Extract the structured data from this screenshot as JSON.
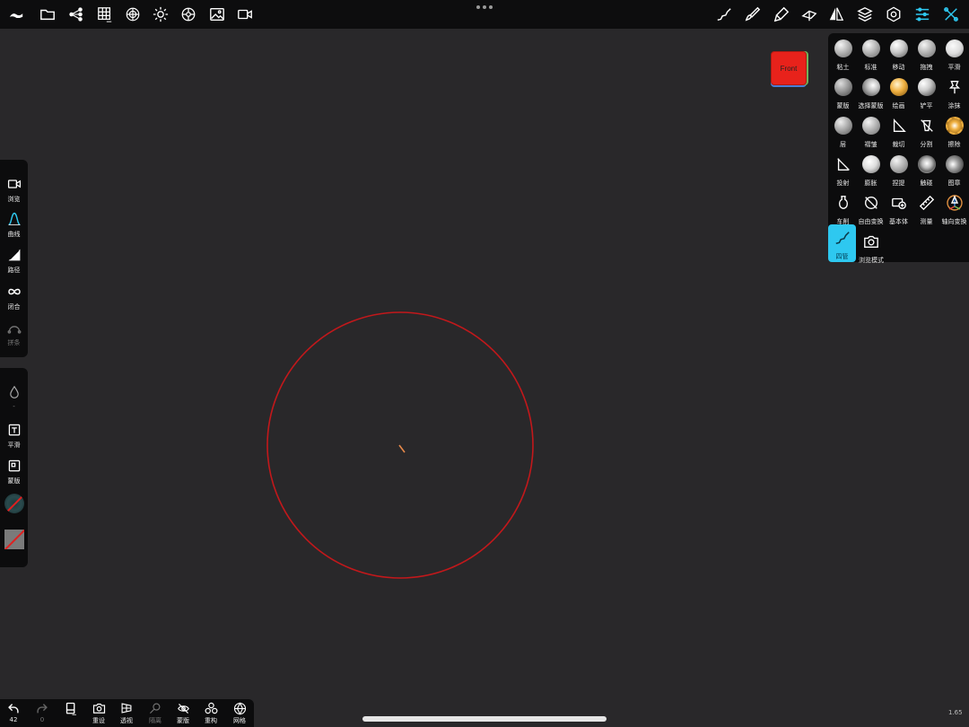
{
  "top_toolbar": {
    "left_icons": [
      "logo-icon",
      "folder-icon",
      "scene-tree-icon",
      "grid-icon",
      "material-sphere-icon",
      "sun-icon",
      "shading-icon",
      "image-icon",
      "camera-icon"
    ],
    "more_dots": "•••",
    "right_icons": [
      "stroke-icon",
      "brush-icon",
      "paint-tube-icon",
      "symmetry-wand-icon",
      "mirror-icon",
      "layers-icon",
      "settings-hex-icon",
      "sliders-icon",
      "tools-icon"
    ],
    "accent_color": "#2ec8f0"
  },
  "orientation_cube": {
    "label": "Front",
    "color": "#e8221b"
  },
  "tool_panel": {
    "tools": [
      {
        "label": "粘土",
        "icon": "sphere-icon"
      },
      {
        "label": "标准",
        "icon": "sphere-icon"
      },
      {
        "label": "移动",
        "icon": "sphere-icon"
      },
      {
        "label": "拖拽",
        "icon": "sphere-icon"
      },
      {
        "label": "平滑",
        "icon": "sphere-icon"
      },
      {
        "label": "蒙版",
        "icon": "sphere-icon"
      },
      {
        "label": "选择蒙版",
        "icon": "sphere-icon"
      },
      {
        "label": "绘画",
        "icon": "sphere-icon"
      },
      {
        "label": "铲平",
        "icon": "sphere-icon"
      },
      {
        "label": "涂抹",
        "icon": "pin-icon"
      },
      {
        "label": "层",
        "icon": "sphere-icon"
      },
      {
        "label": "褶皱",
        "icon": "sphere-icon"
      },
      {
        "label": "裁切",
        "icon": "cut-icon"
      },
      {
        "label": "分割",
        "icon": "split-icon"
      },
      {
        "label": "擦除",
        "icon": "sphere-icon"
      },
      {
        "label": "投射",
        "icon": "project-icon"
      },
      {
        "label": "膨胀",
        "icon": "sphere-icon"
      },
      {
        "label": "捏提",
        "icon": "sphere-icon"
      },
      {
        "label": "触碰",
        "icon": "sphere-icon"
      },
      {
        "label": "图章",
        "icon": "sphere-icon"
      },
      {
        "label": "车削",
        "icon": "lathe-icon"
      },
      {
        "label": "自由变换",
        "icon": "transform-icon"
      },
      {
        "label": "基本体",
        "icon": "primitive-icon"
      },
      {
        "label": "测量",
        "icon": "ruler-icon"
      },
      {
        "label": "轴向变换",
        "icon": "gizmo-icon"
      },
      {
        "label": "四管",
        "icon": "tube-icon",
        "selected": true
      },
      {
        "label": "浏览模式",
        "icon": "camera-mode-icon"
      }
    ]
  },
  "left_panel_top": {
    "items": [
      {
        "label": "浏览",
        "icon": "camera-icon"
      },
      {
        "label": "曲线",
        "icon": "curve-icon"
      },
      {
        "label": "路径",
        "icon": "path-icon"
      },
      {
        "label": "闭合",
        "icon": "infinity-icon"
      },
      {
        "label": "拼条",
        "icon": "arch-icon",
        "dim": true
      }
    ]
  },
  "left_panel_bottom": {
    "drop_value": "-",
    "items": [
      {
        "label": "平滑",
        "icon": "smooth-icon"
      },
      {
        "label": "蒙版",
        "icon": "mask-icon"
      }
    ]
  },
  "bottom_bar": {
    "undo": {
      "count": "42"
    },
    "redo": {
      "count": "0"
    },
    "items": [
      {
        "label": "重设",
        "icon": "reset-camera-icon"
      },
      {
        "label": "透视",
        "icon": "perspective-icon"
      },
      {
        "label": "隔离",
        "icon": "isolate-icon",
        "dim": true
      },
      {
        "label": "蒙版",
        "icon": "hide-icon"
      },
      {
        "label": "重构",
        "icon": "remesh-icon"
      },
      {
        "label": "网格",
        "icon": "wireframe-icon"
      }
    ]
  },
  "version": "1.65",
  "canvas": {
    "stroke_color": "#c2181b"
  }
}
